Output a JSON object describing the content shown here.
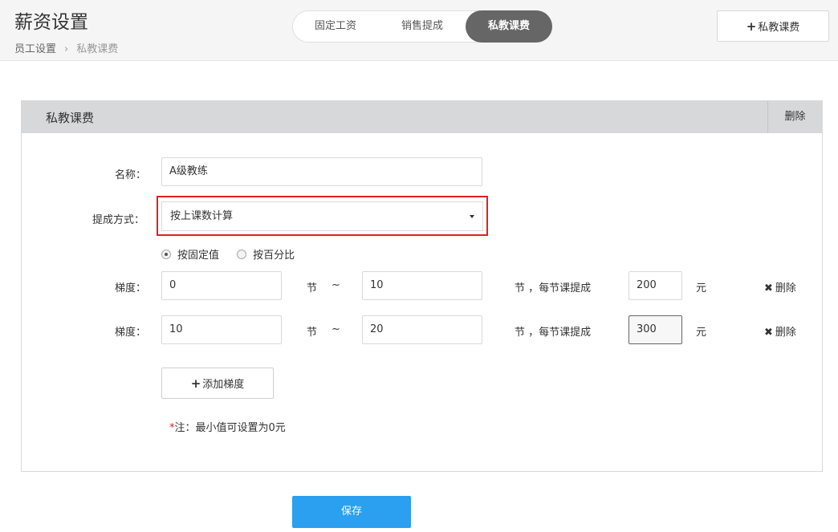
{
  "header": {
    "title": "薪资设置",
    "breadcrumb": [
      "员工设置",
      "私教课费"
    ],
    "breadcrumb_sep": "›",
    "tabs": [
      "固定工资",
      "销售提成",
      "私教课费"
    ],
    "active_tab": 2,
    "add_button_icon": "plus-icon",
    "add_button_label": "私教课费"
  },
  "panel": {
    "title": "私教课费",
    "delete_label": "删除",
    "form": {
      "name_label": "名称：",
      "name_value": "A级教练",
      "method_label": "提成方式：",
      "method_value": "按上课数计算",
      "radios": [
        {
          "label": "按固定值",
          "checked": true
        },
        {
          "label": "按百分比",
          "checked": false
        }
      ],
      "tiers": [
        {
          "label": "梯度：",
          "from": "0",
          "from_unit": "节",
          "tilde": "~",
          "to": "10",
          "rate_text": "节 ，每节课提成",
          "amount": "200",
          "currency": "元",
          "delete_label": "删除"
        },
        {
          "label": "梯度：",
          "from": "10",
          "from_unit": "节",
          "tilde": "~",
          "to": "20",
          "rate_text": "节 ，每节课提成",
          "amount": "300",
          "currency": "元",
          "delete_label": "删除"
        }
      ],
      "add_tier_label": "添加梯度",
      "note_star": "*",
      "note_text": "注：最小值可设置为0元"
    }
  },
  "save_label": "保存",
  "colors": {
    "accent": "#2b9ff0",
    "active_tab": "#666666",
    "highlight_border": "#e02020"
  }
}
